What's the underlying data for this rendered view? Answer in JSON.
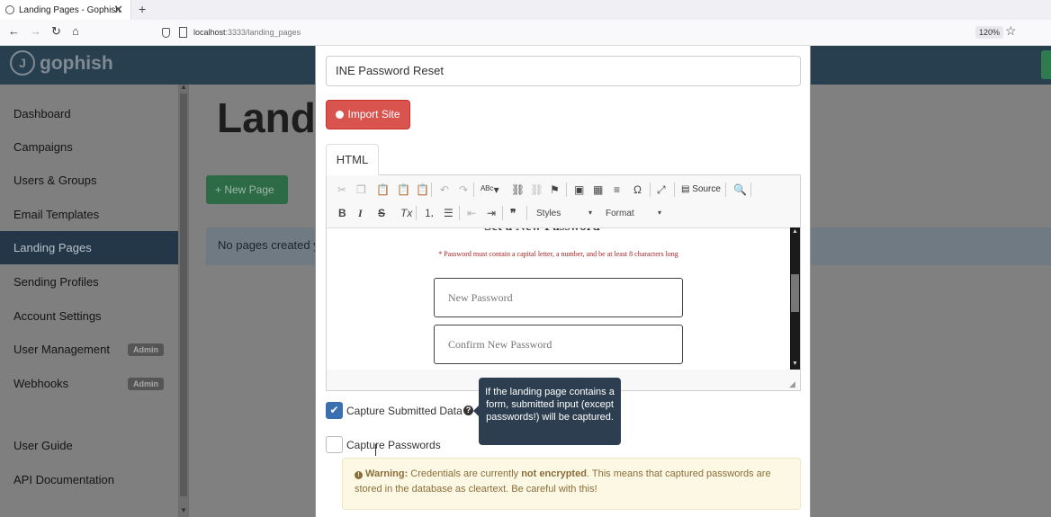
{
  "browser": {
    "tab_title": "Landing Pages - Gophish",
    "tab_close": "✕",
    "new_tab": "+",
    "url_host": "localhost",
    "url_rest": ":3333/landing_pages",
    "zoom": "120%"
  },
  "app": {
    "logo_text": "gophish",
    "logo_mark": "J"
  },
  "sidebar": {
    "items": [
      {
        "label": "Dashboard"
      },
      {
        "label": "Campaigns"
      },
      {
        "label": "Users & Groups"
      },
      {
        "label": "Email Templates"
      },
      {
        "label": "Landing Pages"
      },
      {
        "label": "Sending Profiles"
      },
      {
        "label": "Account Settings"
      },
      {
        "label": "User Management",
        "badge": "Admin"
      },
      {
        "label": "Webhooks",
        "badge": "Admin"
      },
      {
        "label": "User Guide"
      },
      {
        "label": "API Documentation"
      }
    ]
  },
  "main": {
    "title": "Land",
    "new_page": "+ New Page",
    "no_pages": "No pages created y"
  },
  "modal": {
    "name_value": "INE Password Reset",
    "import_label": "Import Site",
    "tab_html": "HTML",
    "toolbar": {
      "source_label": "Source",
      "styles_label": "Styles",
      "format_label": "Format"
    },
    "content": {
      "heading_cut": "Set a New Password",
      "password_note": "* Password must contain a capital letter, a number, and be at least 8 characters long",
      "new_password_placeholder": "New Password",
      "confirm_password_placeholder": "Confirm New Password"
    },
    "capture_submitted_label": "Capture Submitted Data",
    "capture_passwords_label": "Capture Passwords",
    "tooltip": "If the landing page contains a form, submitted input (except passwords!) will be captured.",
    "warning": {
      "title": "Warning:",
      "text_a": " Credentials are currently ",
      "bold": "not encrypted",
      "text_b": ". This means that captured passwords are stored in the database as cleartext. Be careful with this!"
    }
  }
}
